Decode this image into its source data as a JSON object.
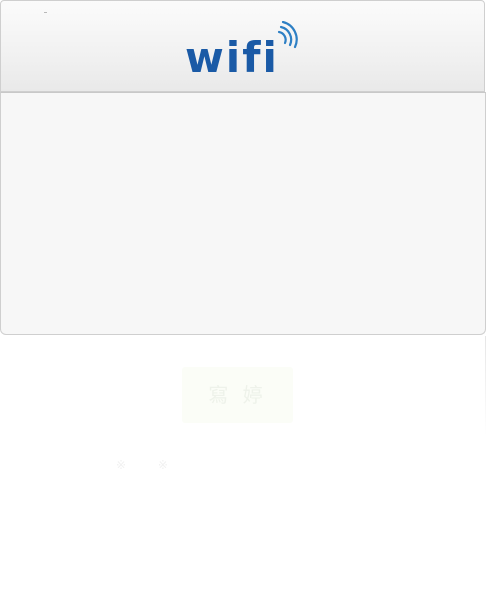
{
  "header": {
    "logo_text": "wifi",
    "logo_color": "#1a5aa6",
    "signal_arc_color": "#2d7fc4"
  },
  "main": {
    "connect_button_label": "寫 婷",
    "footnote_text": "※ ※"
  },
  "colors": {
    "header_background": "#f1f1f1",
    "panel_background": "#f7f7f7",
    "border": "#cfcfcf",
    "button_background": "#fbfdf7",
    "button_text": "#eef2ea"
  }
}
